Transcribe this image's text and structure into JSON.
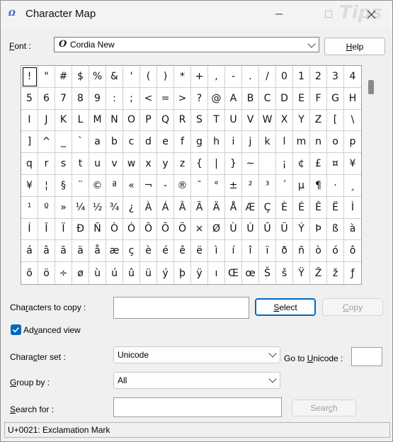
{
  "window": {
    "title": "Character Map",
    "icon": "charmap-app-icon",
    "watermark": "Tips",
    "min_icon": "minimize-icon",
    "max_icon": "maximize-icon",
    "close_icon": "close-icon"
  },
  "font": {
    "label_pre": "",
    "label_hot": "F",
    "label_post": "ont :",
    "value": "Cordia New",
    "icon_glyph": "O",
    "help_hot": "H",
    "help_post": "elp"
  },
  "characters": [
    "!",
    "\"",
    "#",
    "$",
    "%",
    "&",
    "'",
    "(",
    ")",
    "*",
    "+",
    ",",
    "-",
    ".",
    "/",
    "0",
    "1",
    "2",
    "3",
    "4",
    "5",
    "6",
    "7",
    "8",
    "9",
    ":",
    ";",
    "<",
    "=",
    ">",
    "?",
    "@",
    "A",
    "B",
    "C",
    "D",
    "E",
    "F",
    "G",
    "H",
    "I",
    "J",
    "K",
    "L",
    "M",
    "N",
    "O",
    "P",
    "Q",
    "R",
    "S",
    "T",
    "U",
    "V",
    "W",
    "X",
    "Y",
    "Z",
    "[",
    "\\",
    "]",
    "^",
    "_",
    "`",
    "a",
    "b",
    "c",
    "d",
    "e",
    "f",
    "g",
    "h",
    "i",
    "j",
    "k",
    "l",
    "m",
    "n",
    "o",
    "p",
    "q",
    "r",
    "s",
    "t",
    "u",
    "v",
    "w",
    "x",
    "y",
    "z",
    "{",
    "|",
    "}",
    "~",
    " ",
    "¡",
    "¢",
    "£",
    "¤",
    "¥",
    "¥",
    "¦",
    "§",
    "¨",
    "©",
    "ª",
    "«",
    "¬",
    "-",
    "®",
    "¯",
    "°",
    "±",
    "²",
    "³",
    "´",
    "µ",
    "¶",
    "·",
    "¸",
    "¹",
    "º",
    "»",
    "¼",
    "½",
    "¾",
    "¿",
    "À",
    "Á",
    "Â",
    "Ã",
    "Ä",
    "Å",
    "Æ",
    "Ç",
    "È",
    "É",
    "Ê",
    "Ë",
    "Ì",
    "Í",
    "Î",
    "Ï",
    "Ð",
    "Ñ",
    "Ò",
    "Ó",
    "Ô",
    "Õ",
    "Ö",
    "×",
    "Ø",
    "Ù",
    "Ú",
    "Û",
    "Ü",
    "Ý",
    "Þ",
    "ß",
    "à",
    "á",
    "â",
    "ã",
    "ä",
    "å",
    "æ",
    "ç",
    "è",
    "é",
    "ê",
    "ë",
    "ì",
    "í",
    "î",
    "ï",
    "ð",
    "ñ",
    "ò",
    "ó",
    "ô",
    "õ",
    "ö",
    "÷",
    "ø",
    "ù",
    "ú",
    "û",
    "ü",
    "ý",
    "þ",
    "ÿ",
    "ı",
    "Œ",
    "œ",
    "Š",
    "š",
    "Ÿ",
    "Ž",
    "ž",
    "ƒ"
  ],
  "selected_index": 0,
  "copy": {
    "label_pre": "Cha",
    "label_hot": "r",
    "label_post": "acters to copy :",
    "value": "",
    "select_hot": "S",
    "select_post": "elect",
    "copy_hot": "C",
    "copy_post": "opy"
  },
  "advanced": {
    "label_pre": "Ad",
    "label_hot": "v",
    "label_post": "anced view",
    "checked": true
  },
  "charset": {
    "label_pre": "Chara",
    "label_hot": "c",
    "label_post": "ter set :",
    "value": "Unicode",
    "goto_pre": "Go to ",
    "goto_hot": "U",
    "goto_post": "nicode :",
    "goto_value": ""
  },
  "groupby": {
    "label_pre": "",
    "label_hot": "G",
    "label_post": "roup by :",
    "value": "All"
  },
  "search": {
    "label_pre": "",
    "label_hot": "S",
    "label_post": "earch for :",
    "value": "",
    "button_pre": "Sear",
    "button_hot": "c",
    "button_post": "h"
  },
  "status": "U+0021: Exclamation Mark",
  "colors": {
    "accent": "#0067c0",
    "background": "#f0f0f0"
  }
}
